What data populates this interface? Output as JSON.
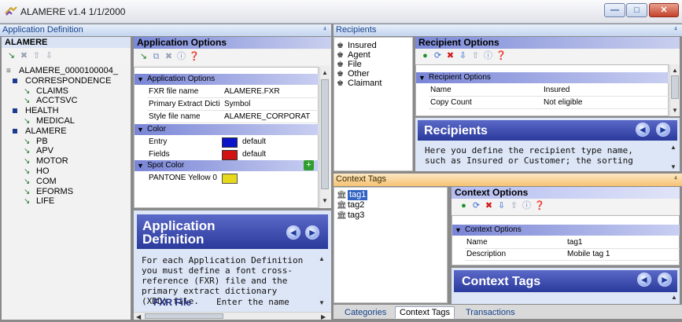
{
  "window": {
    "title": "ALAMERE v1.4 1/1/2000",
    "min_label": "—",
    "max_label": "□",
    "close_label": "✕"
  },
  "app_def_panel": {
    "header": "Application Definition",
    "pin": "⁴",
    "tree_title": "ALAMERE",
    "tree_items": [
      {
        "label": "ALAMERE_0000100004_",
        "type": "root"
      },
      {
        "label": "CORRESPONDENCE",
        "type": "folder"
      },
      {
        "label": "CLAIMS",
        "type": "leaf"
      },
      {
        "label": "ACCTSVC",
        "type": "leaf"
      },
      {
        "label": "HEALTH",
        "type": "folder"
      },
      {
        "label": "MEDICAL",
        "type": "leaf"
      },
      {
        "label": "ALAMERE",
        "type": "folder"
      },
      {
        "label": "PB",
        "type": "leaf"
      },
      {
        "label": "APV",
        "type": "leaf"
      },
      {
        "label": "MOTOR",
        "type": "leaf"
      },
      {
        "label": "HO",
        "type": "leaf"
      },
      {
        "label": "COM",
        "type": "leaf"
      },
      {
        "label": "EFORMS",
        "type": "leaf"
      },
      {
        "label": "LIFE",
        "type": "leaf"
      }
    ]
  },
  "app_options": {
    "title": "Application Options",
    "category": "Application Options",
    "rows": [
      {
        "name": "FXR file name",
        "value": "ALAMERE.FXR"
      },
      {
        "name": "Primary Extract Dicti",
        "value": "Symbol"
      },
      {
        "name": "Style file name",
        "value": "ALAMERE_CORPORAT"
      }
    ],
    "color_cat": "Color",
    "color_rows": [
      {
        "name": "Entry",
        "value": "default",
        "color": "#0a14c8"
      },
      {
        "name": "Fields",
        "value": "default",
        "color": "#d21212"
      }
    ],
    "spot_cat": "Spot Color",
    "spot_row": {
      "name": "PANTONE Yellow 0",
      "color": "#e6d81a"
    }
  },
  "app_help": {
    "title_line1": "Application",
    "title_line2": "Definition",
    "body": [
      "For each Application Definition",
      "you must define a font cross-",
      "reference (FXR) file and the",
      "primary extract dictionary",
      "(XDD) file."
    ],
    "subhead": "FXR File",
    "subtext": "Enter the name"
  },
  "recipients": {
    "header": "Recipients",
    "pin": "⁴",
    "list": [
      "Insured",
      "Agent",
      "File",
      "Other",
      "Claimant"
    ],
    "options_title": "Recipient Options",
    "category": "Recipient Options",
    "rows": [
      {
        "name": "Name",
        "value": "Insured"
      },
      {
        "name": "Copy Count",
        "value": "Not eligible"
      }
    ],
    "help_title": "Recipients",
    "help_body": [
      "Here you define the recipient type name,",
      "such as Insured or Customer; the sorting"
    ]
  },
  "context_tags": {
    "header": "Context Tags",
    "pin": "⁴",
    "tags": [
      "tag1",
      "tag2",
      "tag3"
    ],
    "options_title": "Context Options",
    "category": "Context Options",
    "rows": [
      {
        "name": "Name",
        "value": "tag1"
      },
      {
        "name": "Description",
        "value": "Mobile tag 1"
      }
    ],
    "help_title": "Context Tags"
  },
  "tabs": [
    "Categories",
    "Context Tags",
    "Transactions"
  ],
  "active_tab": "Context Tags"
}
